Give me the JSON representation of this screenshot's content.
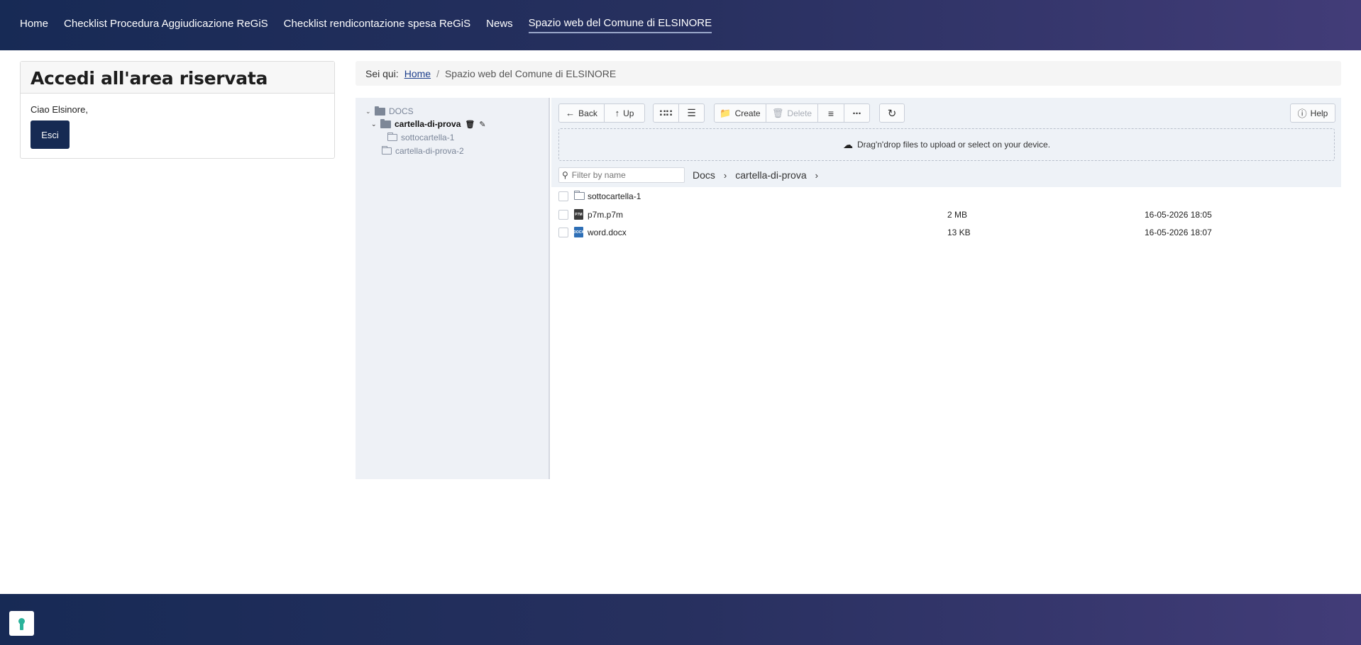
{
  "nav": {
    "items": [
      {
        "label": "Home"
      },
      {
        "label": "Checklist Procedura Aggiudicazione ReGiS"
      },
      {
        "label": "Checklist rendicontazione spesa ReGiS"
      },
      {
        "label": "News"
      },
      {
        "label": "Spazio web del Comune di ELSINORE",
        "active": true
      }
    ]
  },
  "login": {
    "title": "Accedi all'area riservata",
    "greeting": "Ciao Elsinore,",
    "logout_label": "Esci"
  },
  "breadcrumb": {
    "prefix": "Sei qui:",
    "home": "Home",
    "separator": "/",
    "current": "Spazio web del Comune di ELSINORE"
  },
  "tree": {
    "root": "DOCS",
    "items": [
      {
        "label": "cartella-di-prova",
        "selected": true
      },
      {
        "label": "sottocartella-1"
      },
      {
        "label": "cartella-di-prova-2"
      }
    ]
  },
  "toolbar": {
    "back": "Back",
    "up": "Up",
    "create": "Create",
    "delete": "Delete",
    "help": "Help"
  },
  "dropzone": {
    "text": "Drag'n'drop files to upload or select on your device."
  },
  "filter": {
    "placeholder": "Filter by name"
  },
  "path": {
    "segments": [
      "Docs",
      "cartella-di-prova"
    ]
  },
  "files": [
    {
      "name": "sottocartella-1",
      "type": "folder",
      "size": "",
      "date": ""
    },
    {
      "name": "p7m.p7m",
      "type": "p7m",
      "size": "2 MB",
      "date": "16-05-2026 18:05"
    },
    {
      "name": "word.docx",
      "type": "docx",
      "size": "13 KB",
      "date": "16-05-2026 18:07"
    }
  ],
  "icons": {
    "p7m_badge": "P7M",
    "docx_badge": "DOCX"
  },
  "colors": {
    "nav_gradient_start": "#172a55",
    "nav_gradient_end": "#423c78",
    "logout_button": "#162a53",
    "link": "#1c3e8c",
    "accessibility": "#2bb39b"
  }
}
